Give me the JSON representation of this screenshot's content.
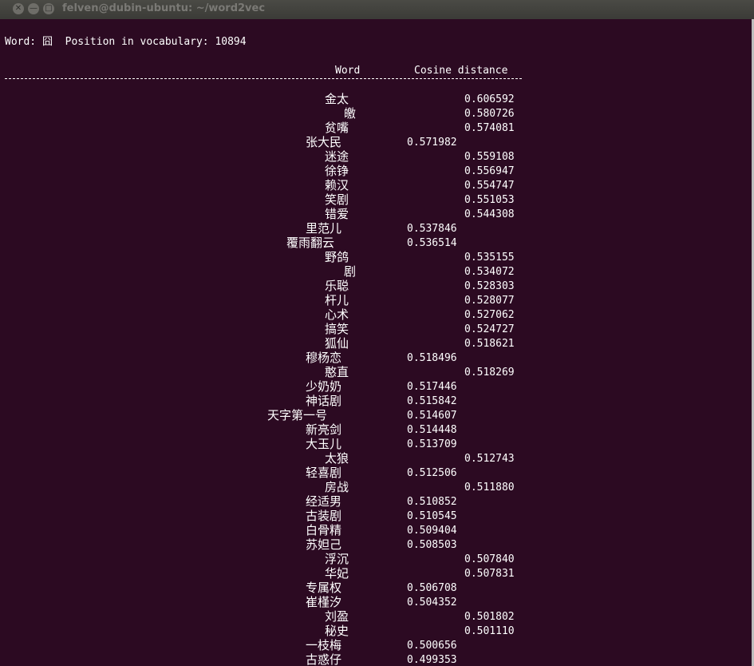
{
  "window": {
    "title": "felven@dubin-ubuntu: ~/word2vec",
    "close_glyph": "✕",
    "minimize_glyph": "—",
    "maximize_glyph": "□"
  },
  "terminal": {
    "query_line": "Word: 囧  Position in vocabulary: 10894",
    "header_word": "Word",
    "header_distance": "Cosine distance",
    "results": [
      {
        "word": "金太",
        "distance": "0.606592"
      },
      {
        "word": "皦",
        "distance": "0.580726"
      },
      {
        "word": "贫嘴",
        "distance": "0.574081"
      },
      {
        "word": "张大民",
        "distance": "0.571982"
      },
      {
        "word": "迷途",
        "distance": "0.559108"
      },
      {
        "word": "徐铮",
        "distance": "0.556947"
      },
      {
        "word": "赖汉",
        "distance": "0.554747"
      },
      {
        "word": "笑剧",
        "distance": "0.551053"
      },
      {
        "word": "错爱",
        "distance": "0.544308"
      },
      {
        "word": "里范儿",
        "distance": "0.537846"
      },
      {
        "word": "覆雨翻云",
        "distance": "0.536514"
      },
      {
        "word": "野鸽",
        "distance": "0.535155"
      },
      {
        "word": "剧",
        "distance": "0.534072"
      },
      {
        "word": "乐聪",
        "distance": "0.528303"
      },
      {
        "word": "杆儿",
        "distance": "0.528077"
      },
      {
        "word": "心术",
        "distance": "0.527062"
      },
      {
        "word": "搞笑",
        "distance": "0.524727"
      },
      {
        "word": "狐仙",
        "distance": "0.518621"
      },
      {
        "word": "穆杨恋",
        "distance": "0.518496"
      },
      {
        "word": "憨直",
        "distance": "0.518269"
      },
      {
        "word": "少奶奶",
        "distance": "0.517446"
      },
      {
        "word": "神话剧",
        "distance": "0.515842"
      },
      {
        "word": "天字第一号",
        "distance": "0.514607"
      },
      {
        "word": "新亮剑",
        "distance": "0.514448"
      },
      {
        "word": "大玉儿",
        "distance": "0.513709"
      },
      {
        "word": "太狼",
        "distance": "0.512743"
      },
      {
        "word": "轻喜剧",
        "distance": "0.512506"
      },
      {
        "word": "房战",
        "distance": "0.511880"
      },
      {
        "word": "经适男",
        "distance": "0.510852"
      },
      {
        "word": "古装剧",
        "distance": "0.510545"
      },
      {
        "word": "白骨精",
        "distance": "0.509404"
      },
      {
        "word": "苏妲己",
        "distance": "0.508503"
      },
      {
        "word": "浮沉",
        "distance": "0.507840"
      },
      {
        "word": "华妃",
        "distance": "0.507831"
      },
      {
        "word": "专属权",
        "distance": "0.506708"
      },
      {
        "word": "崔槿汐",
        "distance": "0.504352"
      },
      {
        "word": "刘盈",
        "distance": "0.501802"
      },
      {
        "word": "秘史",
        "distance": "0.501110"
      },
      {
        "word": "一枝梅",
        "distance": "0.500656"
      },
      {
        "word": "古惑仔",
        "distance": "0.499353"
      }
    ]
  }
}
